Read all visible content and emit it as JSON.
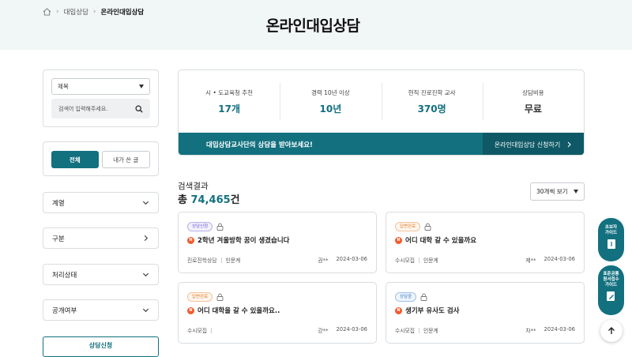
{
  "breadcrumb": {
    "items": [
      "대입상담",
      "온라인대입상담"
    ]
  },
  "page_title": "온라인대입상담",
  "sidebar": {
    "search": {
      "field_select": "제목",
      "placeholder": "검색어 입력해주세요."
    },
    "toggle": {
      "all": "전체",
      "mine": "내가 쓴 글"
    },
    "filters": [
      {
        "label": "계열",
        "icon": "chevron-down-icon"
      },
      {
        "label": "구분",
        "icon": "chevron-right-icon"
      },
      {
        "label": "처리상태",
        "icon": "chevron-down-icon"
      },
      {
        "label": "공개여부",
        "icon": "chevron-down-icon"
      }
    ],
    "apply_label": "상담신청"
  },
  "stats": [
    {
      "label": "시 • 도교육청 추천",
      "value": "17개"
    },
    {
      "label": "경력 10년 이상",
      "value": "10년"
    },
    {
      "label": "현직 진로진학 교사",
      "value": "370명"
    },
    {
      "label": "상담비용",
      "value": "무료"
    }
  ],
  "banner": {
    "text": "대입상담교사단의 상담을 받아보세요!",
    "button": "온라인대입상담 신청하기"
  },
  "results": {
    "label": "검색결과",
    "count_prefix": "총 ",
    "count": "74,465",
    "count_suffix": "건",
    "per_page": "30개씩 보기"
  },
  "cards": [
    {
      "badge": "상담신청",
      "badge_color": "#6a5acd",
      "title": "2학년 겨울방학 꿈이 생겼습니다",
      "category": "진로진학상담",
      "type": "인문계",
      "author": "권**",
      "date": "2024-03-06"
    },
    {
      "badge": "답변완료",
      "badge_color": "#e07b2a",
      "title": "어디 대학 갈 수 있을까요",
      "category": "수시모집",
      "type": "인문계",
      "author": "제**",
      "date": "2024-03-06"
    },
    {
      "badge": "답변완료",
      "badge_color": "#e07b2a",
      "title": "어디 대학을 갈 수 있을까요..",
      "category": "수시모집",
      "type": "",
      "author": "강**",
      "date": "2024-03-06"
    },
    {
      "badge": "상담중",
      "badge_color": "#3478c5",
      "title": "생기부 유사도 검사",
      "category": "수시모집",
      "type": "인문계",
      "author": "차**",
      "date": "2024-03-06"
    }
  ],
  "floating": {
    "beginner_guide": [
      "초보자",
      "가이드"
    ],
    "standard_guide": [
      "표준공통",
      "원서접수",
      "가이드"
    ]
  },
  "colors": {
    "accent": "#13707f",
    "accent_dark": "#0f5966",
    "new_dot": "#f25a2c"
  }
}
